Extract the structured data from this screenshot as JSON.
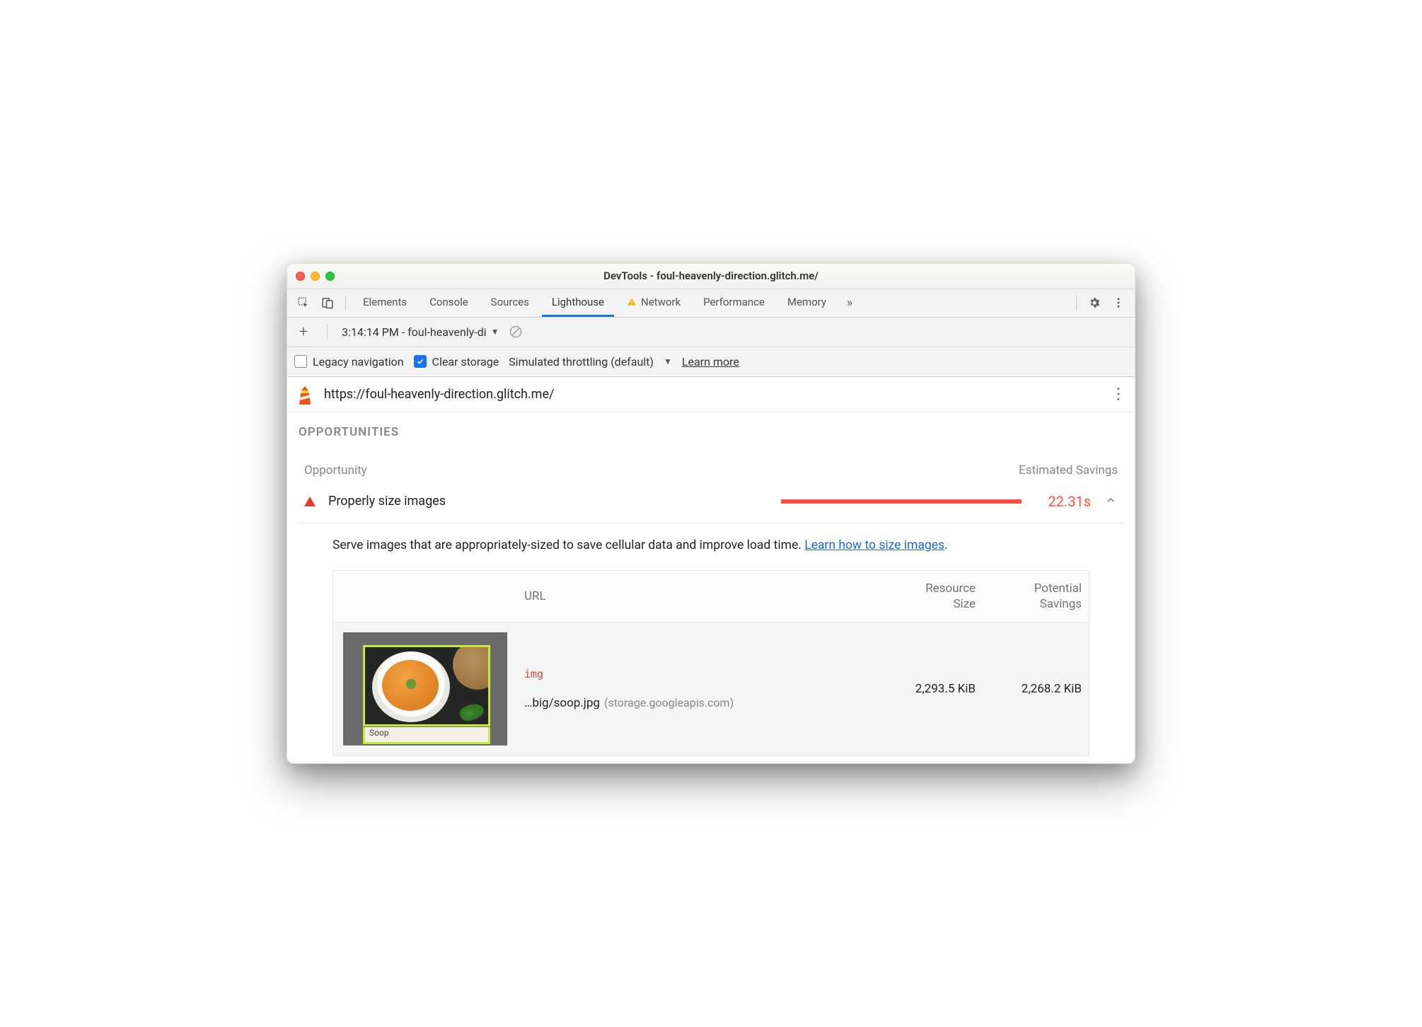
{
  "window": {
    "title": "DevTools - foul-heavenly-direction.glitch.me/"
  },
  "tabs": {
    "items": [
      "Elements",
      "Console",
      "Sources",
      "Lighthouse",
      "Network",
      "Performance",
      "Memory"
    ],
    "active": "Lighthouse",
    "network_warning": true
  },
  "subrow": {
    "report_label": "3:14:14 PM - foul-heavenly-di"
  },
  "options": {
    "legacy_nav_label": "Legacy navigation",
    "legacy_nav_checked": false,
    "clear_storage_label": "Clear storage",
    "clear_storage_checked": true,
    "throttling_label": "Simulated throttling (default)",
    "learn_more": "Learn more"
  },
  "url_bar": {
    "url": "https://foul-heavenly-direction.glitch.me/"
  },
  "section": {
    "heading": "OPPORTUNITIES",
    "col_left": "Opportunity",
    "col_right": "Estimated Savings"
  },
  "opportunity": {
    "name": "Properly size images",
    "savings": "22.31s",
    "desc_prefix": "Serve images that are appropriately-sized to save cellular data and improve load time. ",
    "desc_link": "Learn how to size images",
    "desc_suffix": "."
  },
  "table": {
    "col_url": "URL",
    "col_size_l1": "Resource",
    "col_size_l2": "Size",
    "col_pot_l1": "Potential",
    "col_pot_l2": "Savings",
    "row": {
      "tag": "img",
      "path": "…big/soop.jpg",
      "host": "(storage.googleapis.com)",
      "resource_size": "2,293.5 KiB",
      "potential_savings": "2,268.2 KiB",
      "thumb_caption": "Soop"
    }
  }
}
